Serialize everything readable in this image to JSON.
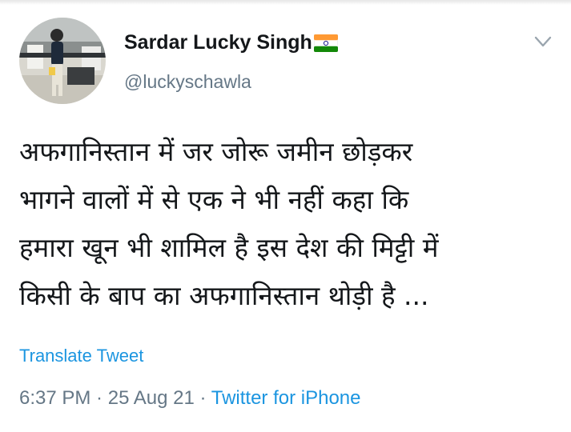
{
  "tweet": {
    "author": {
      "display_name": "Sardar Lucky Singh",
      "name_emoji": "indian-flag-icon",
      "handle": "@luckyschawla",
      "avatar": "profile-photo"
    },
    "menu_icon": "chevron-down-icon",
    "text_lines": [
      "अफगानिस्तान में जर जोरू जमीन छोड़कर",
      "भागने वालों में से एक ने भी नहीं कहा कि",
      "हमारा खून भी शामिल है इस देश की मिट्टी में",
      "किसी के बाप का अफगानिस्तान थोड़ी है ..."
    ],
    "translate_label": "Translate Tweet",
    "time": "6:37 PM",
    "separator": " · ",
    "date": "25 Aug 21",
    "source": "Twitter for iPhone"
  },
  "colors": {
    "link": "#1b95e0",
    "secondary_text": "#657786",
    "primary_text": "#14171a",
    "flag_saffron": "#ff9933",
    "flag_green": "#138808",
    "flag_chakra": "#000080"
  }
}
